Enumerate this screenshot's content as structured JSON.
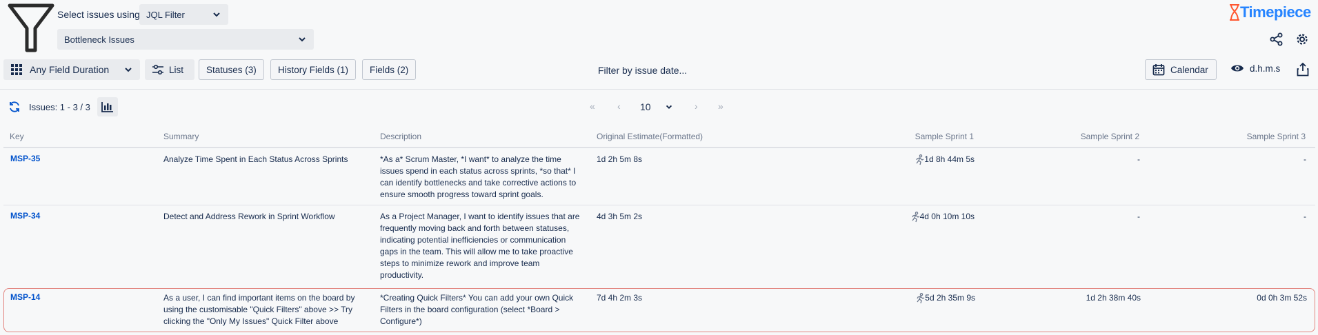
{
  "header": {
    "select_label": "Select issues using",
    "filter_type": "JQL Filter",
    "filter_name": "Bottleneck Issues",
    "brand": "Timepiece"
  },
  "toolbar": {
    "report_type": "Any Field Duration",
    "list_label": "List",
    "statuses_label": "Statuses (3)",
    "history_fields_label": "History Fields (1)",
    "fields_label": "Fields (2)",
    "date_filter_label": "Filter by issue date...",
    "calendar_label": "Calendar",
    "time_format_label": "d.h.m.s"
  },
  "results": {
    "count_label": "Issues: 1 - 3 / 3",
    "page_size": "10"
  },
  "table": {
    "columns": [
      "Key",
      "Summary",
      "Description",
      "Original Estimate(Formatted)",
      "Sample Sprint 1",
      "Sample Sprint 2",
      "Sample Sprint 3"
    ],
    "rows": [
      {
        "key": "MSP-35",
        "summary": [
          "Analyze Time Spent in Each Status Across Sprints"
        ],
        "description": [
          "*As a* Scrum Master, *I want* to analyze the time",
          "issues spend in each status across sprints, *so that* I",
          "can identify bottlenecks and take corrective actions to",
          "ensure smooth progress toward sprint goals."
        ],
        "estimate": "1d 2h 5m 8s",
        "sprint1": "1d 8h 44m 5s",
        "sprint2": "-",
        "sprint3": "-"
      },
      {
        "key": "MSP-34",
        "summary": [
          "Detect and Address Rework in Sprint Workflow"
        ],
        "description": [
          "As a Project Manager, I want to identify issues that are",
          "frequently moving back and forth between statuses,",
          "indicating potential inefficiencies or communication",
          "gaps in the team. This will allow me to take proactive",
          "steps to minimize rework and improve team",
          "productivity."
        ],
        "estimate": "4d 3h 5m 2s",
        "sprint1": "4d 0h 10m 10s",
        "sprint2": "-",
        "sprint3": "-"
      },
      {
        "key": "MSP-14",
        "summary": [
          "As a user, I can find important items on the board by",
          "using the customisable \"Quick Filters\" above >> Try",
          "clicking the \"Only My Issues\" Quick Filter above"
        ],
        "description": [
          "*Creating Quick Filters* You can add your own Quick",
          "Filters in the board configuration (select *Board >",
          "Configure*)"
        ],
        "estimate": "7d 4h 2m 3s",
        "sprint1": "5d 2h 35m 9s",
        "sprint2": "1d 2h 38m 40s",
        "sprint3": "0d 0h 3m 52s"
      }
    ]
  }
}
